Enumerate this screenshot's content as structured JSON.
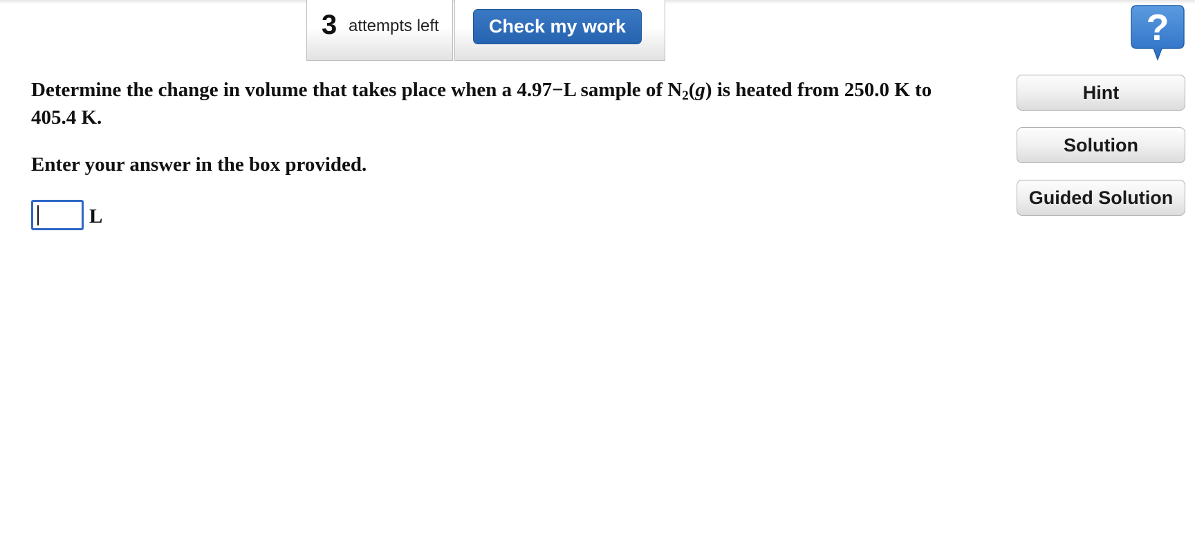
{
  "toolbar": {
    "attempts_count": "3",
    "attempts_label": "attempts left",
    "check_label": "Check my work"
  },
  "question": {
    "text_before_sub": "Determine the change in volume that takes place when a 4.97−L sample of N",
    "subscript": "2",
    "phase_open": "(",
    "phase": "g",
    "text_after_phase": ") is heated from 250.0 K to 405.4 K.",
    "instruction": "Enter your answer in the box provided."
  },
  "answer": {
    "value": "",
    "unit": "L"
  },
  "side_buttons": {
    "hint_label": "Hint",
    "solution_label": "Solution",
    "guided_label": "Guided Solution"
  },
  "help": {
    "icon": "question-mark-bubble-icon"
  },
  "colors": {
    "primary_button": "#2d6bbb",
    "input_border": "#2d66c5",
    "help_icon": "#3a7fd0"
  }
}
